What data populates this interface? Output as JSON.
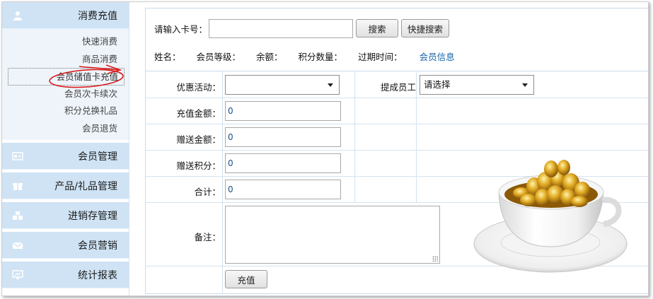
{
  "sidebar": {
    "sections": [
      {
        "label": "消费充值",
        "icon": "user-icon"
      },
      {
        "label": "会员管理",
        "icon": "id-card-icon"
      },
      {
        "label": "产品/礼品管理",
        "icon": "gift-icon"
      },
      {
        "label": "进销存管理",
        "icon": "boxes-icon"
      },
      {
        "label": "会员营销",
        "icon": "envelope-icon"
      },
      {
        "label": "统计报表",
        "icon": "monitor-icon"
      }
    ],
    "subitems": [
      "快速消费",
      "商品消费",
      "会员储值卡充值",
      "会员次卡续次",
      "积分兑换礼品",
      "会员退货"
    ],
    "active_subitem": "会员储值卡充值"
  },
  "search": {
    "label": "请输入卡号：",
    "card_value": "",
    "search_button": "搜索",
    "quick_search_button": "快捷搜索"
  },
  "info": {
    "name": "姓名：",
    "level": "会员等级：",
    "balance": "余额：",
    "points": "积分数量：",
    "expiry": "过期时间：",
    "member_link": "会员信息"
  },
  "form": {
    "promo_label": "优惠活动：",
    "promo_value": "",
    "staff_label": "提成员工",
    "staff_value": "请选择",
    "amount_label": "充值金额：",
    "amount_value": "0",
    "gift_amount_label": "赠送金额：",
    "gift_amount_value": "0",
    "gift_points_label": "赠送积分：",
    "gift_points_value": "0",
    "total_label": "合计：",
    "total_value": "0",
    "remark_label": "备注：",
    "remark_value": "",
    "submit_button": "充值"
  },
  "colors": {
    "sidebar_header": "#cfe3f5",
    "link": "#1463a8",
    "annotation": "#d81e1e"
  }
}
